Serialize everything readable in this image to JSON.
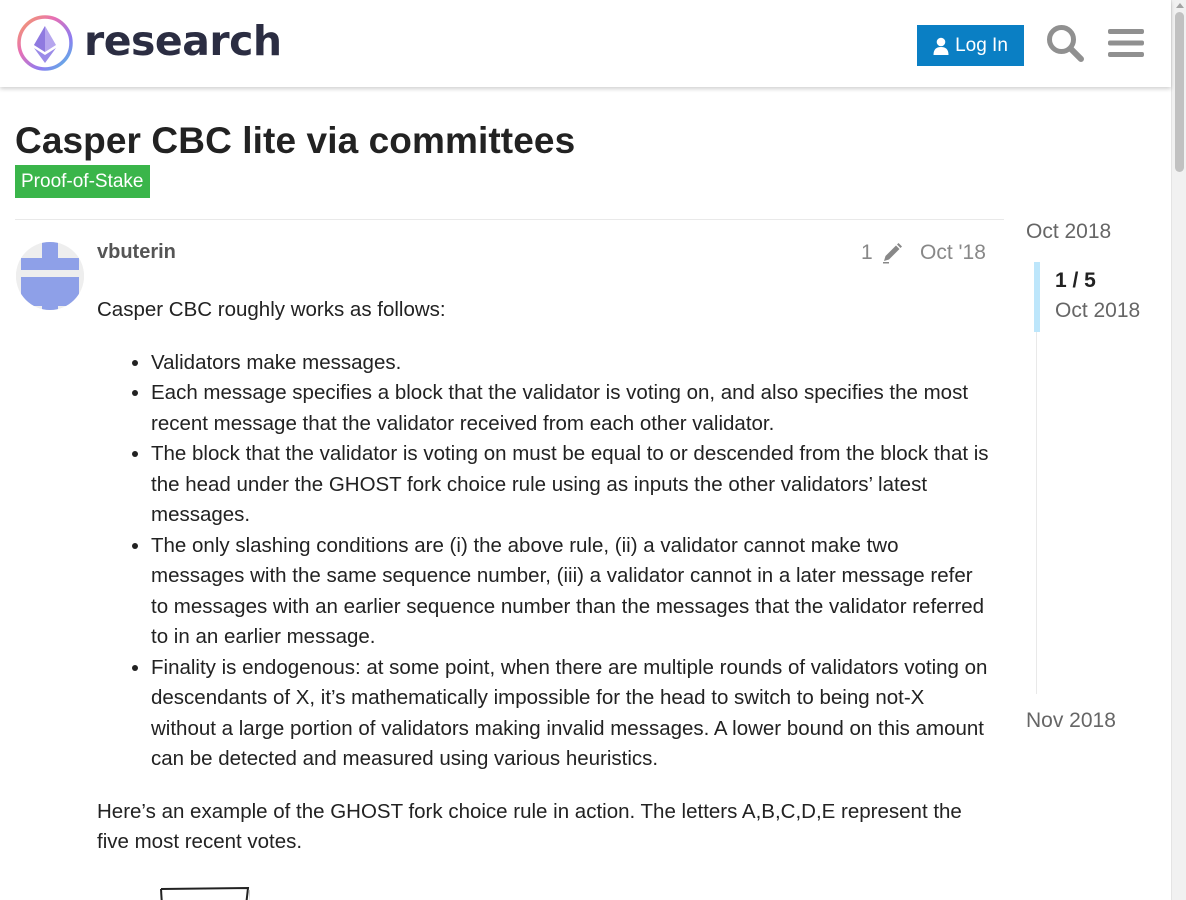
{
  "header": {
    "logo_text": "research",
    "login_label": "Log In",
    "accent_color": "#0a7fc4"
  },
  "topic": {
    "title": "Casper CBC lite via committees",
    "category": "Proof-of-Stake",
    "category_color": "#3ab54a"
  },
  "post": {
    "username": "vbuterin",
    "edit_count": "1",
    "date": "Oct '18",
    "intro": "Casper CBC roughly works as follows:",
    "bullets": [
      "Validators make messages.",
      "Each message specifies a block that the validator is voting on, and also specifies the most recent message that the validator received from each other validator.",
      "The block that the validator is voting on must be equal to or descended from the block that is the head under the GHOST fork choice rule using as inputs the other validators’ latest messages.",
      "The only slashing conditions are (i) the above rule, (ii) a validator cannot make two messages with the same sequence number, (iii) a validator cannot in a later message refer to messages with an earlier sequence number than the messages that the validator referred to in an earlier message.",
      "Finality is endogenous: at some point, when there are multiple rounds of validators voting on descendants of X, it’s mathematically impossible for the head to switch to being not-X without a large portion of validators making invalid messages. A lower bound on this amount can be detected and measured using various heuristics."
    ],
    "outro": "Here’s an example of the GHOST fork choice rule in action. The letters A,B,C,D,E represent the five most recent votes."
  },
  "timeline": {
    "start_date": "Oct 2018",
    "position": "1 / 5",
    "current_date": "Oct 2018",
    "end_date": "Nov 2018"
  },
  "icons": [
    "logo-icon",
    "user-icon",
    "search-icon",
    "menu-icon",
    "pencil-icon"
  ]
}
